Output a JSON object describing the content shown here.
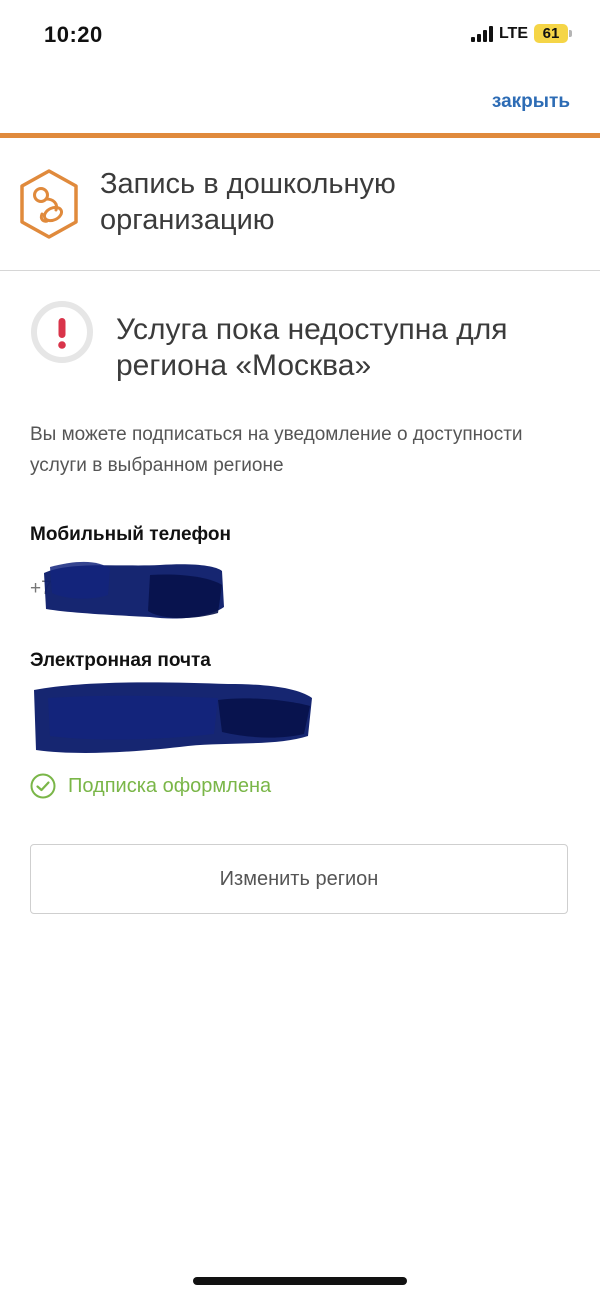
{
  "status_bar": {
    "time": "10:20",
    "network": "LTE",
    "battery": "61",
    "colors": {
      "battery_fill": "#f5d547"
    }
  },
  "header": {
    "close_label": "закрыть",
    "accent_color": "#e08a3c",
    "link_color": "#2d6cb5"
  },
  "service": {
    "title": "Запись в дошкольную организацию",
    "icon": "pacifier-hexagon-icon"
  },
  "alert": {
    "icon": "exclamation-circle-icon",
    "title": "Услуга пока недоступна для региона «Москва»"
  },
  "notice": {
    "text": "Вы можете подписаться на уведомление о доступности услуги в выбранном регионе"
  },
  "fields": {
    "phone": {
      "label": "Мобильный телефон",
      "value": "+7"
    },
    "email": {
      "label": "Электронная почта",
      "value": ""
    }
  },
  "subscription": {
    "icon": "check-circle-icon",
    "status": "Подписка оформлена",
    "color": "#7ab648"
  },
  "actions": {
    "change_region_label": "Изменить регион"
  }
}
